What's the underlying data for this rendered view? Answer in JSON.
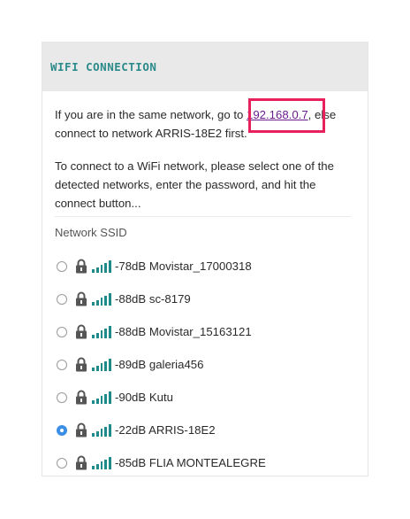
{
  "header": {
    "title": "WIFI CONNECTION"
  },
  "intro": {
    "before": "If you are in the same network, go to ",
    "ip": "192.168.0.7",
    "after": ", else connect to network ARRIS-18E2 first."
  },
  "instructions": "To connect to a WiFi network, please select one of the detected networks, enter the password, and hit the connect button...",
  "ssid_header": "Network SSID",
  "networks": [
    {
      "label": "-78dB Movistar_17000318",
      "selected": false
    },
    {
      "label": "-88dB sc-8179",
      "selected": false
    },
    {
      "label": "-88dB Movistar_15163121",
      "selected": false
    },
    {
      "label": "-89dB galeria456",
      "selected": false
    },
    {
      "label": "-90dB Kutu",
      "selected": false
    },
    {
      "label": "-22dB ARRIS-18E2",
      "selected": true
    },
    {
      "label": "-85dB FLIA MONTEALEGRE",
      "selected": false
    }
  ],
  "colors": {
    "accent": "#2b8a8a",
    "link": "#6b1d8e",
    "highlight": "#e8205b",
    "radio_selected": "#3b8fe6"
  }
}
